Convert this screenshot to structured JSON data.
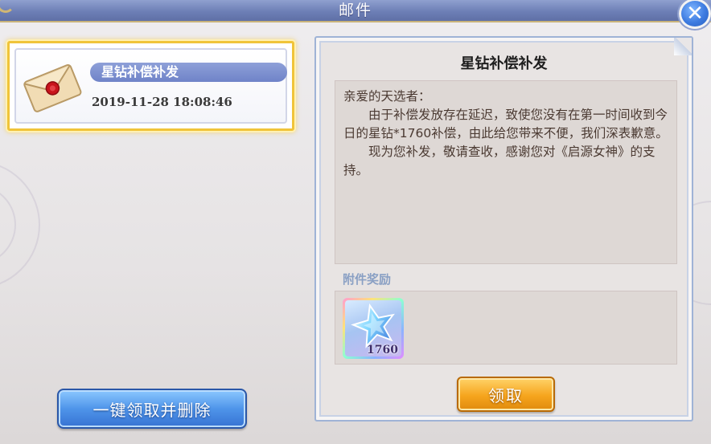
{
  "window": {
    "title": "邮件",
    "close_icon": "close-icon"
  },
  "mail_list": {
    "items": [
      {
        "subject": "星钻补偿补发",
        "date": "2019-11-28  18:08:46",
        "icon": "sealed-envelope-icon",
        "selected": true
      }
    ],
    "collect_all_label": "一键领取并删除"
  },
  "detail": {
    "title": "星钻补偿补发",
    "greeting": "亲爱的天选者：",
    "paragraph1": "由于补偿发放存在延迟，致使您没有在第一时间收到今日的星钻*1760补偿，由此给您带来不便，我们深表歉意。",
    "paragraph2": "现为您补发，敬请查收，感谢您对《启源女神》的支持。",
    "attachments_label": "附件奖励",
    "attachments": [
      {
        "icon": "star-diamond-icon",
        "quantity": "1760"
      }
    ],
    "claim_label": "领取"
  },
  "colors": {
    "title_bar": "#6d7fb6",
    "selected_border": "#f0c43a",
    "subject_pill": "#7b8fd0",
    "claim_button": "#f6a51d",
    "collect_all_button": "#4f95ea",
    "body_text": "#4b3a32",
    "attach_label": "#8aa0c4"
  }
}
